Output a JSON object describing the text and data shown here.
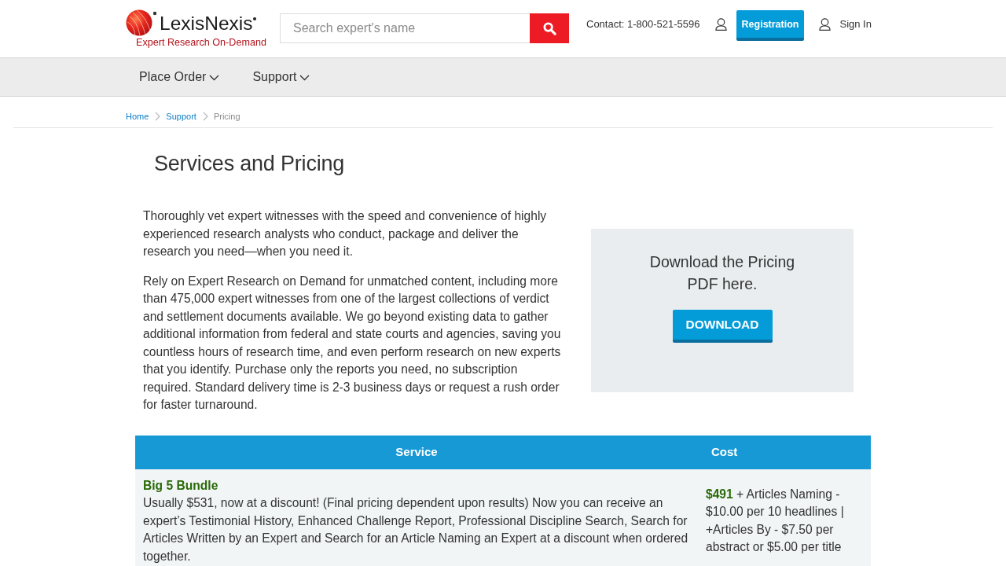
{
  "header": {
    "logo": {
      "wordmark": "LexisNexis",
      "tagline": "Expert Research On-Demand"
    },
    "search": {
      "placeholder": "Search expert's name"
    },
    "contact": "Contact: 1-800-521-5596",
    "registration_button": "Registration",
    "sign_in": "Sign In"
  },
  "nav": {
    "items": [
      {
        "label": "Place Order"
      },
      {
        "label": "Support"
      }
    ]
  },
  "breadcrumb": [
    {
      "label": "Home",
      "kind": "link"
    },
    {
      "label": "Support",
      "kind": "link"
    },
    {
      "label": "Pricing",
      "kind": "current"
    }
  ],
  "page_title": "Services and Pricing",
  "intro_paragraphs": [
    "Thoroughly vet expert witnesses with the speed and convenience of highly experienced research analysts who conduct, package and deliver the research you need—when you need it.",
    "Rely on Expert Research on Demand for unmatched content, including more than 475,000 expert witnesses from one of the largest collections of verdict and settlement documents available. We go beyond existing data to gather additional information from federal and state courts and agencies, saving you countless hours of research time, and even perform research on new experts that you identify. Purchase only the reports you need, no subscription required. Standard delivery time is 2-3 business days or request a rush order for faster turnaround."
  ],
  "download_box": {
    "text": "Download the Pricing PDF here.",
    "button": "DOWNLOAD"
  },
  "pricing_table": {
    "columns": [
      "Service",
      "Cost"
    ],
    "rows": [
      {
        "service_name": "Big 5 Bundle",
        "description": "Usually $531, now at a discount! (Final pricing dependent upon results) Now you can receive an expert’s Testimonial History, Enhanced Challenge Report, Professional Discipline Search, Search for Articles Written by an Expert and Search for an Article Naming an Expert at a discount when ordered together.",
        "cost": "**$491** + Articles Naming - $10.00 per 10 headlines | +Articles By - $7.50 per abstract or $5.00 per title"
      }
    ]
  }
}
